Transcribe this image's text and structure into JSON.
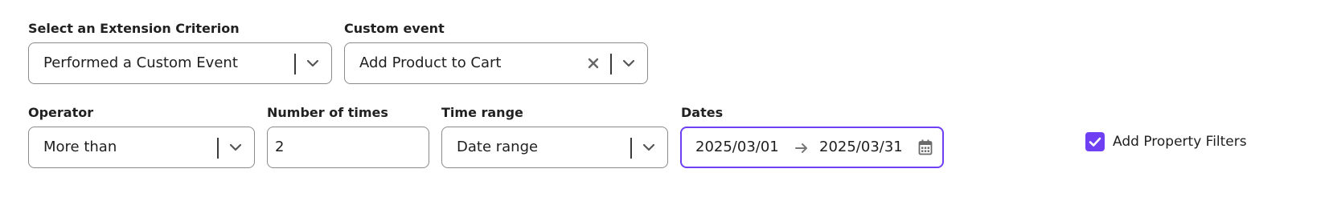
{
  "criterion": {
    "label": "Select an Extension Criterion",
    "value": "Performed a Custom Event",
    "chevron_icon": "chevron-down-icon"
  },
  "custom_event": {
    "label": "Custom event",
    "value": "Add Product to Cart",
    "clear_icon": "close-icon",
    "chevron_icon": "chevron-down-icon"
  },
  "operator": {
    "label": "Operator",
    "value": "More than",
    "chevron_icon": "chevron-down-icon"
  },
  "number_of_times": {
    "label": "Number of times",
    "value": "2"
  },
  "time_range": {
    "label": "Time range",
    "value": "Date range",
    "chevron_icon": "chevron-down-icon"
  },
  "dates": {
    "label": "Dates",
    "start": "2025/03/01",
    "end": "2025/03/31",
    "arrow_icon": "arrow-right-icon",
    "calendar_icon": "calendar-icon"
  },
  "property_filters": {
    "label": "Add Property Filters",
    "checked": true
  },
  "colors": {
    "accent": "#6e3ff3",
    "border": "#8a8a8a",
    "text": "#1f1f1f"
  }
}
